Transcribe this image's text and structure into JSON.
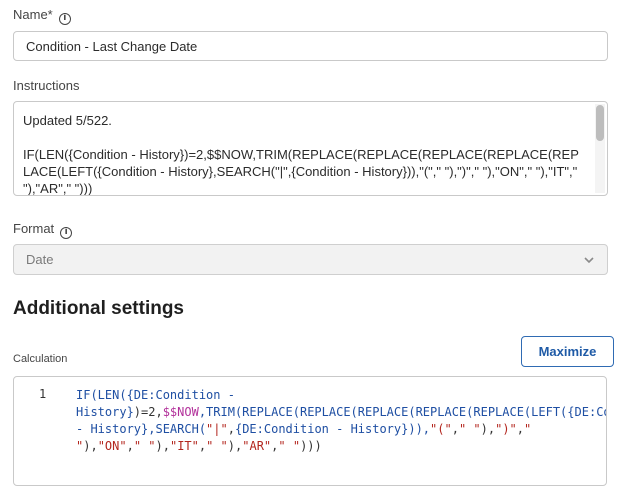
{
  "name_field": {
    "label": "Name*",
    "value": "Condition - Last Change Date"
  },
  "instructions": {
    "label": "Instructions",
    "text": "Updated 5/522.\n\nIF(LEN({Condition - History})=2,$$NOW,TRIM(REPLACE(REPLACE(REPLACE(REPLACE(REPLACE(LEFT({Condition - History},SEARCH(\"|\",{Condition - History})),\"(\",\" \"),\")\",\" \"),\"ON\",\" \"),\"IT\",\" \"),\"AR\",\" \")))"
  },
  "format": {
    "label": "Format",
    "selected": "Date"
  },
  "additional_settings": {
    "title": "Additional settings"
  },
  "calculation": {
    "label": "Calculation",
    "maximize_label": "Maximize",
    "line_number": "1",
    "code_tokens": [
      {
        "t": "IF(LEN(",
        "c": "fn"
      },
      {
        "t": "{DE:Condition - History}",
        "c": "fn"
      },
      {
        "t": ")=2,",
        "c": "plain"
      },
      {
        "t": "$$NOW",
        "c": "var"
      },
      {
        "t": ",TRIM(REPLACE(REPLACE(REPLACE(REPLACE(REPLACE(LEFT(",
        "c": "fn"
      },
      {
        "t": "{DE:Condition - History}",
        "c": "fn"
      },
      {
        "t": ",SEARCH(",
        "c": "fn"
      },
      {
        "t": "\"|\"",
        "c": "str"
      },
      {
        "t": ",",
        "c": "plain"
      },
      {
        "t": "{DE:Condition - History}",
        "c": "fn"
      },
      {
        "t": ")),",
        "c": "fn"
      },
      {
        "t": "\"(\"",
        "c": "str"
      },
      {
        "t": ",",
        "c": "plain"
      },
      {
        "t": "\" \"",
        "c": "str"
      },
      {
        "t": "),",
        "c": "plain"
      },
      {
        "t": "\")\"",
        "c": "str"
      },
      {
        "t": ",",
        "c": "plain"
      },
      {
        "t": "\" \"",
        "c": "str"
      },
      {
        "t": "),",
        "c": "plain"
      },
      {
        "t": "\"ON\"",
        "c": "str"
      },
      {
        "t": ",",
        "c": "plain"
      },
      {
        "t": "\" \"",
        "c": "str"
      },
      {
        "t": "),",
        "c": "plain"
      },
      {
        "t": "\"IT\"",
        "c": "str"
      },
      {
        "t": ",",
        "c": "plain"
      },
      {
        "t": "\" \"",
        "c": "str"
      },
      {
        "t": "),",
        "c": "plain"
      },
      {
        "t": "\"AR\"",
        "c": "str"
      },
      {
        "t": ",",
        "c": "plain"
      },
      {
        "t": "\" \"",
        "c": "str"
      },
      {
        "t": ")))",
        "c": "plain"
      }
    ]
  },
  "icons": {
    "info": "info-icon",
    "chevron": "chevron-down-icon"
  },
  "colors": {
    "accent": "#1e5aa6",
    "function": "#1f4fa3",
    "variable": "#b2309a",
    "string": "#b3261e"
  }
}
